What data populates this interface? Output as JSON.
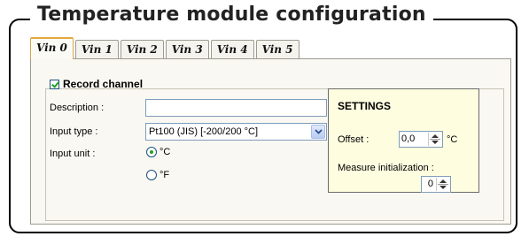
{
  "frame_title": "Temperature module configuration",
  "tabs": [
    {
      "label": "Vin 0",
      "active": true
    },
    {
      "label": "Vin 1",
      "active": false
    },
    {
      "label": "Vin 2",
      "active": false
    },
    {
      "label": "Vin 3",
      "active": false
    },
    {
      "label": "Vin 4",
      "active": false
    },
    {
      "label": "Vin 5",
      "active": false
    }
  ],
  "record_channel": {
    "label": "Record channel",
    "checked": true
  },
  "description": {
    "label": "Description :",
    "value": ""
  },
  "input_type": {
    "label": "Input type :",
    "value": "Pt100 (JIS) [-200/200 °C]"
  },
  "input_unit": {
    "label": "Input unit :",
    "options": [
      {
        "label": "°C",
        "selected": true
      },
      {
        "label": "°F",
        "selected": false
      }
    ]
  },
  "settings": {
    "title": "SETTINGS",
    "offset_label": "Offset :",
    "offset_value": "0,0",
    "offset_unit": "°C",
    "measure_label": "Measure initialization :",
    "measure_value": "0"
  },
  "colors": {
    "active_tab_border": "#e5a93c",
    "settings_bg": "#fffde0",
    "panel_bg": "#f9f8f2",
    "check_mark": "#21a121"
  },
  "icons": {
    "dropdown": "chevron-down-icon",
    "spinner": "spin-updown-icon"
  }
}
